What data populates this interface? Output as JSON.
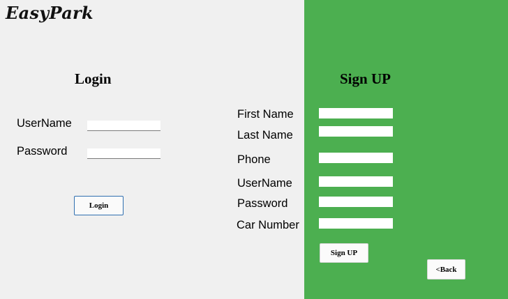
{
  "app": {
    "title": "EasyPark"
  },
  "login": {
    "heading": "Login",
    "username_label": "UserName",
    "username_value": "",
    "password_label": "Password",
    "password_value": "",
    "button_label": "Login"
  },
  "signup": {
    "heading": "Sign UP",
    "first_name_label": "First Name",
    "first_name_value": "",
    "last_name_label": "Last Name",
    "last_name_value": "",
    "phone_label": "Phone",
    "phone_value": "",
    "username_label": "UserName",
    "username_value": "",
    "password_label": "Password",
    "password_value": "",
    "car_number_label": "Car Number",
    "car_number_value": "",
    "button_label": "Sign UP"
  },
  "nav": {
    "back_label": "<Back"
  },
  "colors": {
    "panel_green": "#4caf50",
    "background": "#f0f0f0",
    "login_button_border": "#2f6fb0"
  }
}
